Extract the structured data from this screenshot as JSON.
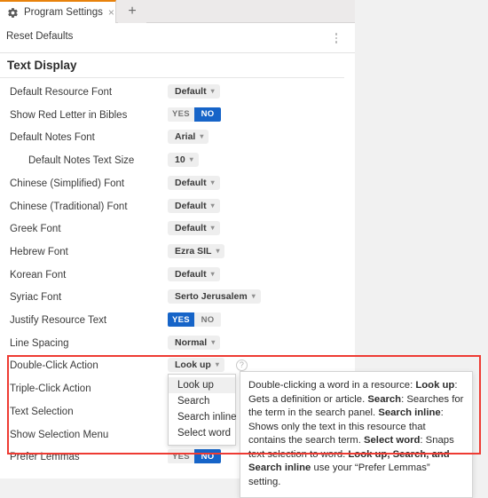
{
  "window": {
    "tabs": [
      {
        "label": "Program Settings",
        "icon": "gear-icon",
        "close_icon": "×",
        "active": true
      }
    ],
    "new_tab_icon": "+",
    "accent_color": "#e8820c"
  },
  "command_bar": {
    "reset_label": "Reset Defaults",
    "overflow_icon": "kebab-menu-icon"
  },
  "section": {
    "title": "Text Display"
  },
  "settings": [
    {
      "label": "Default Resource Font",
      "type": "dropdown",
      "value": "Default",
      "indent": false
    },
    {
      "label": "Show Red Letter in Bibles",
      "type": "toggle",
      "yes": "YES",
      "no": "NO",
      "selected": "NO",
      "indent": false
    },
    {
      "label": "Default Notes Font",
      "type": "dropdown",
      "value": "Arial",
      "indent": false
    },
    {
      "label": "Default Notes Text Size",
      "type": "dropdown",
      "value": "10",
      "indent": true
    },
    {
      "label": "Chinese (Simplified) Font",
      "type": "dropdown",
      "value": "Default",
      "indent": false
    },
    {
      "label": "Chinese (Traditional) Font",
      "type": "dropdown",
      "value": "Default",
      "indent": false
    },
    {
      "label": "Greek Font",
      "type": "dropdown",
      "value": "Default",
      "indent": false
    },
    {
      "label": "Hebrew Font",
      "type": "dropdown",
      "value": "Ezra SIL",
      "indent": false
    },
    {
      "label": "Korean Font",
      "type": "dropdown",
      "value": "Default",
      "indent": false
    },
    {
      "label": "Syriac Font",
      "type": "dropdown",
      "value": "Serto Jerusalem",
      "indent": false
    },
    {
      "label": "Justify Resource Text",
      "type": "toggle",
      "yes": "YES",
      "no": "NO",
      "selected": "YES",
      "indent": false
    },
    {
      "label": "Line Spacing",
      "type": "dropdown",
      "value": "Normal",
      "indent": false
    },
    {
      "label": "Double-Click Action",
      "type": "dropdown",
      "value": "Look up",
      "help": "?",
      "indent": false
    },
    {
      "label": "Triple-Click Action",
      "type": "none",
      "indent": false
    },
    {
      "label": "Text Selection",
      "type": "none",
      "indent": false
    },
    {
      "label": "Show Selection Menu",
      "type": "none",
      "indent": false
    },
    {
      "label": "Prefer Lemmas",
      "type": "toggle",
      "yes": "YES",
      "no": "NO",
      "selected": "NO",
      "indent": false
    }
  ],
  "double_click_menu": {
    "items": [
      {
        "label": "Look up",
        "selected": true
      },
      {
        "label": "Search",
        "selected": false
      },
      {
        "label": "Search inline",
        "selected": false
      },
      {
        "label": "Select word",
        "selected": false
      }
    ]
  },
  "tooltip": {
    "segments": [
      {
        "text": "Double-clicking a word in a resource: ",
        "bold": false
      },
      {
        "text": "Look up",
        "bold": true
      },
      {
        "text": ": Gets a definition or article. ",
        "bold": false
      },
      {
        "text": "Search",
        "bold": true
      },
      {
        "text": ": Searches for the term in the search panel. ",
        "bold": false
      },
      {
        "text": "Search inline",
        "bold": true
      },
      {
        "text": ": Shows only the text in this resource that contains the search term. ",
        "bold": false
      },
      {
        "text": "Select word",
        "bold": true
      },
      {
        "text": ": Snaps text selection to word. ",
        "bold": false
      },
      {
        "text": "Look up, Search, and Search inline",
        "bold": true
      },
      {
        "text": " use your “Prefer Lemmas” setting.",
        "bold": false
      }
    ]
  },
  "highlight": {
    "color": "#ee3b33"
  },
  "dropdown_caret": "▾"
}
